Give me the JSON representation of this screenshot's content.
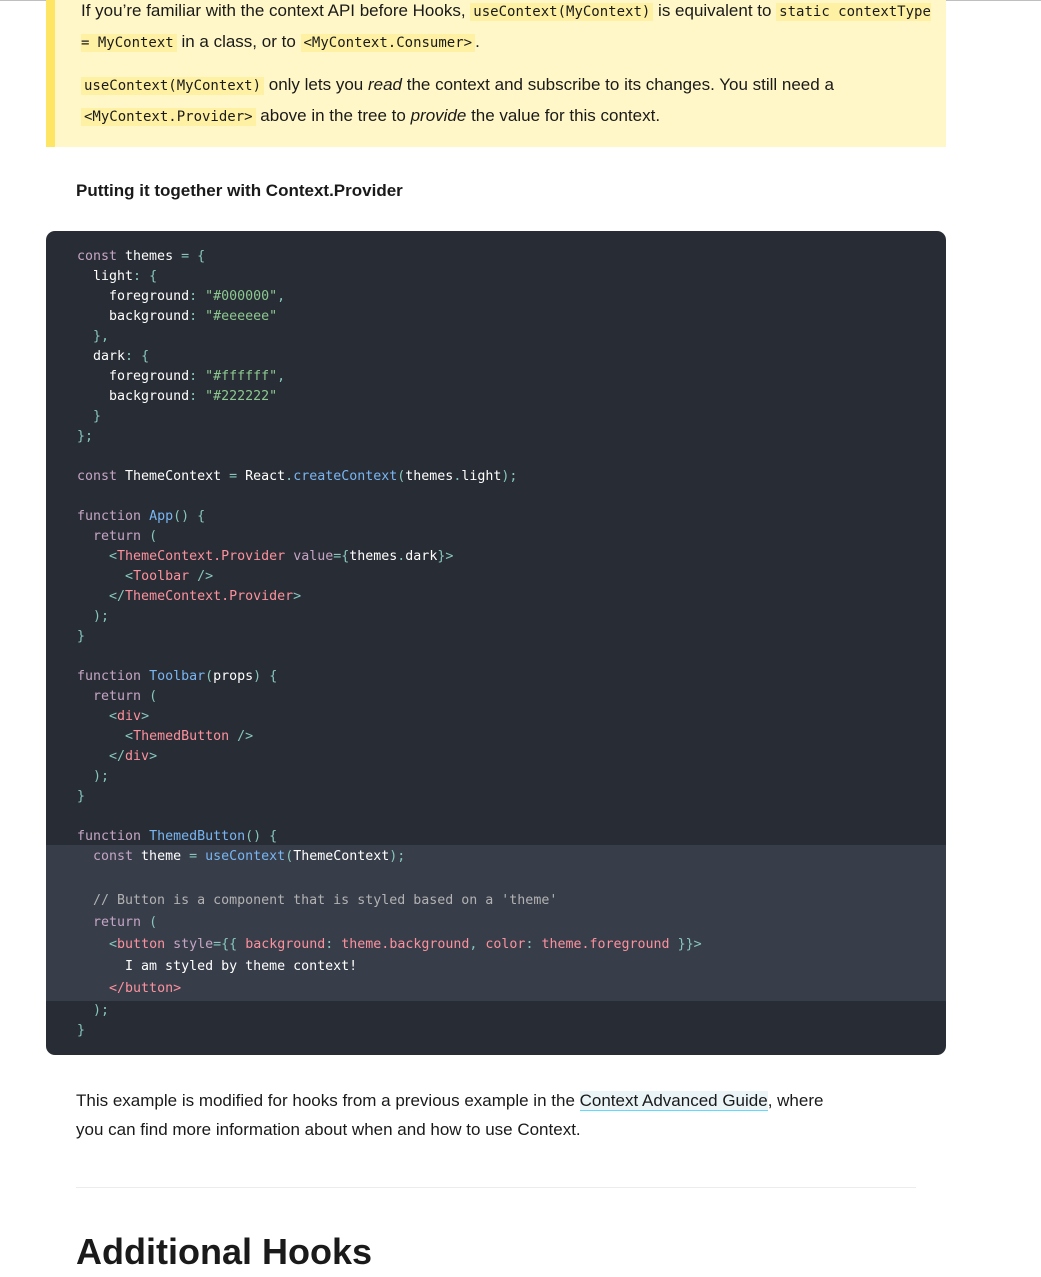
{
  "note": {
    "p1": [
      {
        "t": "text",
        "v": "If you’re familiar with the context API before Hooks, "
      },
      {
        "t": "code",
        "v": "useContext(MyContext)"
      },
      {
        "t": "text",
        "v": " is equivalent to "
      },
      {
        "t": "code",
        "v": "static contextType = MyContext"
      },
      {
        "t": "text",
        "v": " in a class, or to "
      },
      {
        "t": "code",
        "v": "<MyContext.Consumer>"
      },
      {
        "t": "text",
        "v": "."
      }
    ],
    "p2": [
      {
        "t": "code",
        "v": "useContext(MyContext)"
      },
      {
        "t": "text",
        "v": " only lets you "
      },
      {
        "t": "em",
        "v": "read"
      },
      {
        "t": "text",
        "v": " the context and subscribe to its changes. You still need a "
      },
      {
        "t": "code",
        "v": "<MyContext.Provider>"
      },
      {
        "t": "text",
        "v": " above in the tree to "
      },
      {
        "t": "em",
        "v": "provide"
      },
      {
        "t": "text",
        "v": " the value for this context."
      }
    ]
  },
  "section_heading": "Putting it together with Context.Provider",
  "code": {
    "lines": [
      [
        [
          "kw",
          "const"
        ],
        [
          "txt",
          " themes "
        ],
        [
          "punc",
          "="
        ],
        [
          "txt",
          " "
        ],
        [
          "punc",
          "{"
        ]
      ],
      [
        [
          "txt",
          "  light"
        ],
        [
          "punc",
          ":"
        ],
        [
          "txt",
          " "
        ],
        [
          "punc",
          "{"
        ]
      ],
      [
        [
          "txt",
          "    foreground"
        ],
        [
          "punc",
          ":"
        ],
        [
          "txt",
          " "
        ],
        [
          "str",
          "\"#000000\""
        ],
        [
          "punc",
          ","
        ]
      ],
      [
        [
          "txt",
          "    background"
        ],
        [
          "punc",
          ":"
        ],
        [
          "txt",
          " "
        ],
        [
          "str",
          "\"#eeeeee\""
        ]
      ],
      [
        [
          "txt",
          "  "
        ],
        [
          "punc",
          "},"
        ]
      ],
      [
        [
          "txt",
          "  dark"
        ],
        [
          "punc",
          ":"
        ],
        [
          "txt",
          " "
        ],
        [
          "punc",
          "{"
        ]
      ],
      [
        [
          "txt",
          "    foreground"
        ],
        [
          "punc",
          ":"
        ],
        [
          "txt",
          " "
        ],
        [
          "str",
          "\"#ffffff\""
        ],
        [
          "punc",
          ","
        ]
      ],
      [
        [
          "txt",
          "    background"
        ],
        [
          "punc",
          ":"
        ],
        [
          "txt",
          " "
        ],
        [
          "str",
          "\"#222222\""
        ]
      ],
      [
        [
          "txt",
          "  "
        ],
        [
          "punc",
          "}"
        ]
      ],
      [
        [
          "punc",
          "};"
        ]
      ],
      [],
      [
        [
          "kw",
          "const"
        ],
        [
          "txt",
          " ThemeContext "
        ],
        [
          "punc",
          "="
        ],
        [
          "txt",
          " React"
        ],
        [
          "punc",
          "."
        ],
        [
          "fn",
          "createContext"
        ],
        [
          "punc",
          "("
        ],
        [
          "txt",
          "themes"
        ],
        [
          "punc",
          "."
        ],
        [
          "txt",
          "light"
        ],
        [
          "punc",
          ");"
        ]
      ],
      [],
      [
        [
          "kw",
          "function"
        ],
        [
          "txt",
          " "
        ],
        [
          "fn",
          "App"
        ],
        [
          "punc",
          "()"
        ],
        [
          "txt",
          " "
        ],
        [
          "punc",
          "{"
        ]
      ],
      [
        [
          "txt",
          "  "
        ],
        [
          "kw",
          "return"
        ],
        [
          "txt",
          " "
        ],
        [
          "punc",
          "("
        ]
      ],
      [
        [
          "txt",
          "    "
        ],
        [
          "punc",
          "<"
        ],
        [
          "tag",
          "ThemeContext.Provider"
        ],
        [
          "txt",
          " "
        ],
        [
          "attr",
          "value"
        ],
        [
          "punc",
          "={"
        ],
        [
          "txt",
          "themes"
        ],
        [
          "punc",
          "."
        ],
        [
          "txt",
          "dark"
        ],
        [
          "punc",
          "}>"
        ]
      ],
      [
        [
          "txt",
          "      "
        ],
        [
          "punc",
          "<"
        ],
        [
          "tag",
          "Toolbar"
        ],
        [
          "txt",
          " "
        ],
        [
          "punc",
          "/>"
        ]
      ],
      [
        [
          "txt",
          "    "
        ],
        [
          "punc",
          "</"
        ],
        [
          "tag",
          "ThemeContext.Provider"
        ],
        [
          "punc",
          ">"
        ]
      ],
      [
        [
          "txt",
          "  "
        ],
        [
          "punc",
          ");"
        ]
      ],
      [
        [
          "punc",
          "}"
        ]
      ],
      [],
      [
        [
          "kw",
          "function"
        ],
        [
          "txt",
          " "
        ],
        [
          "fn",
          "Toolbar"
        ],
        [
          "punc",
          "("
        ],
        [
          "txt",
          "props"
        ],
        [
          "punc",
          ")"
        ],
        [
          "txt",
          " "
        ],
        [
          "punc",
          "{"
        ]
      ],
      [
        [
          "txt",
          "  "
        ],
        [
          "kw",
          "return"
        ],
        [
          "txt",
          " "
        ],
        [
          "punc",
          "("
        ]
      ],
      [
        [
          "txt",
          "    "
        ],
        [
          "punc",
          "<"
        ],
        [
          "tag",
          "div"
        ],
        [
          "punc",
          ">"
        ]
      ],
      [
        [
          "txt",
          "      "
        ],
        [
          "punc",
          "<"
        ],
        [
          "tag",
          "ThemedButton"
        ],
        [
          "txt",
          " "
        ],
        [
          "punc",
          "/>"
        ]
      ],
      [
        [
          "txt",
          "    "
        ],
        [
          "punc",
          "</"
        ],
        [
          "tag",
          "div"
        ],
        [
          "punc",
          ">"
        ]
      ],
      [
        [
          "txt",
          "  "
        ],
        [
          "punc",
          ");"
        ]
      ],
      [
        [
          "punc",
          "}"
        ]
      ],
      [],
      [
        [
          "kw",
          "function"
        ],
        [
          "txt",
          " "
        ],
        [
          "fn",
          "ThemedButton"
        ],
        [
          "punc",
          "()"
        ],
        [
          "txt",
          " "
        ],
        [
          "punc",
          "{"
        ]
      ],
      [
        [
          "txt",
          "  "
        ],
        [
          "kw",
          "const"
        ],
        [
          "txt",
          " theme "
        ],
        [
          "punc",
          "="
        ],
        [
          "txt",
          " "
        ],
        [
          "fn",
          "useContext"
        ],
        [
          "punc",
          "("
        ],
        [
          "txt",
          "ThemeContext"
        ],
        [
          "punc",
          ");"
        ]
      ],
      [],
      [
        [
          "txt",
          "  "
        ],
        [
          "com",
          "// Button is a component that is styled based on a 'theme'"
        ]
      ],
      [
        [
          "txt",
          "  "
        ],
        [
          "kw",
          "return"
        ],
        [
          "txt",
          " "
        ],
        [
          "punc",
          "("
        ]
      ],
      [
        [
          "txt",
          "    "
        ],
        [
          "punc",
          "<"
        ],
        [
          "tag",
          "button"
        ],
        [
          "txt",
          " "
        ],
        [
          "attr",
          "style"
        ],
        [
          "punc",
          "={{"
        ],
        [
          "txt",
          " "
        ],
        [
          "tag",
          "background"
        ],
        [
          "punc",
          ":"
        ],
        [
          "txt",
          " "
        ],
        [
          "tag",
          "theme.background"
        ],
        [
          "punc",
          ","
        ],
        [
          "txt",
          " "
        ],
        [
          "tag",
          "color"
        ],
        [
          "punc",
          ":"
        ],
        [
          "txt",
          " "
        ],
        [
          "tag",
          "theme.foreground"
        ],
        [
          "txt",
          " "
        ],
        [
          "punc",
          "}}>"
        ]
      ],
      [
        [
          "txt",
          "      I am styled by theme context!"
        ]
      ],
      [
        [
          "txt",
          "    "
        ],
        [
          "tag",
          "</button>"
        ]
      ],
      [
        [
          "txt",
          "  "
        ],
        [
          "punc",
          ");"
        ]
      ],
      [
        [
          "punc",
          "}"
        ]
      ]
    ]
  },
  "paragraph": {
    "before": "This example is modified for hooks from a previous example in the ",
    "link": "Context Advanced Guide",
    "after": ", where you can find more information about when and how to use Context."
  },
  "h2": "Additional Hooks"
}
